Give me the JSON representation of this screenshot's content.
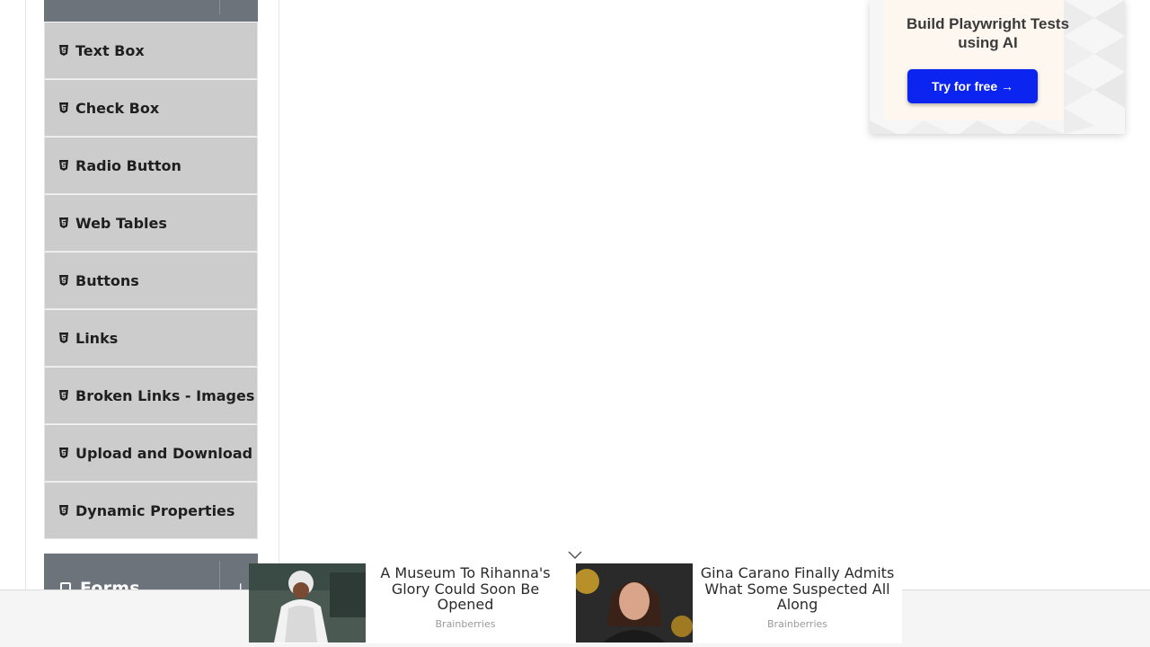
{
  "sidebar": {
    "items": [
      {
        "label": "Text Box",
        "icon": "html5-icon"
      },
      {
        "label": "Check Box",
        "icon": "html5-icon"
      },
      {
        "label": "Radio Button",
        "icon": "html5-icon"
      },
      {
        "label": "Web Tables",
        "icon": "html5-icon"
      },
      {
        "label": "Buttons",
        "icon": "html5-icon"
      },
      {
        "label": "Links",
        "icon": "html5-icon"
      },
      {
        "label": "Broken Links - Images",
        "icon": "html5-icon"
      },
      {
        "label": "Upload and Download",
        "icon": "html5-icon"
      },
      {
        "label": "Dynamic Properties",
        "icon": "html5-icon"
      }
    ],
    "forms_group": {
      "title": "Forms"
    }
  },
  "ad_card": {
    "title": "Build Playwright Tests using AI",
    "button_label": "Try for free →",
    "button_color": "#0b24f0"
  },
  "news_ads": [
    {
      "headline": "A Museum To Rihanna's Glory Could Soon Be Opened",
      "source": "Brainberries"
    },
    {
      "headline": "Gina Carano Finally Admits What Some Suspected All Along",
      "source": "Brainberries"
    }
  ],
  "colors": {
    "menu_item_bg": "#cccccc",
    "group_header_bg": "#6c737b"
  }
}
